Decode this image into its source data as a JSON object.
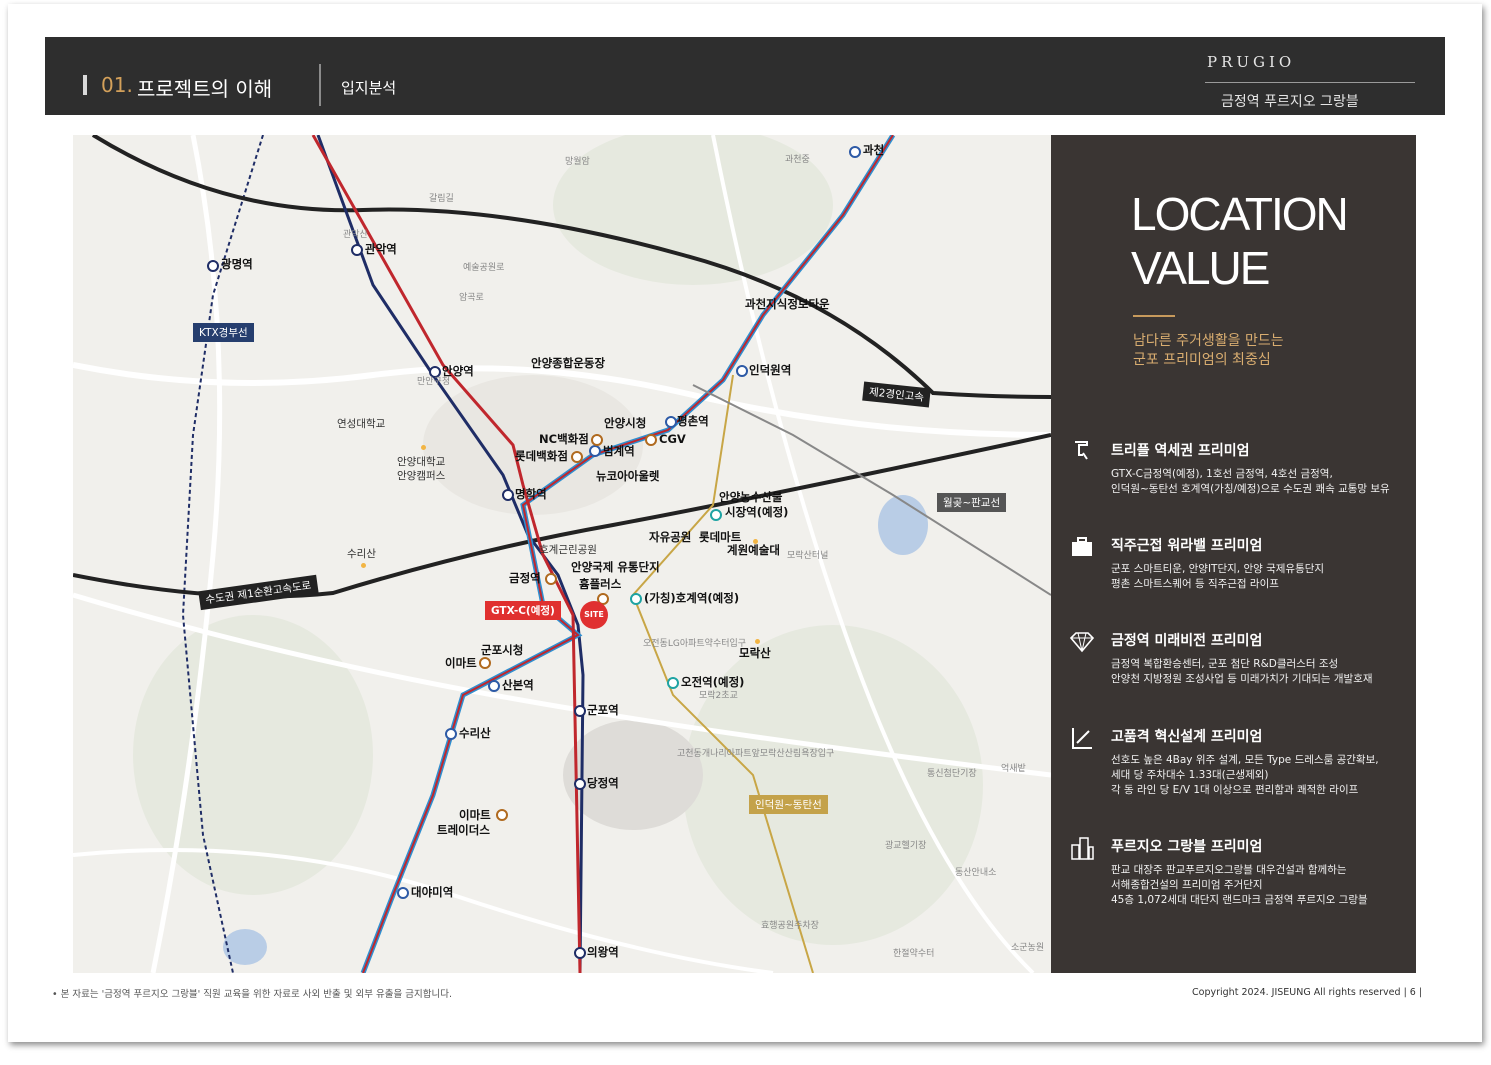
{
  "header": {
    "section_number": "01.",
    "section_title": "프로젝트의 이해",
    "subsection": "입지분석",
    "brand": "PRUGIO",
    "brand_sub": "금정역 푸르지오 그랑블"
  },
  "map": {
    "site_label": "SITE",
    "stations": [
      "과천",
      "관악역",
      "광명역",
      "안양역",
      "과천지식정보타운",
      "인덕원역",
      "안양시청",
      "평촌역",
      "범계역",
      "명학역",
      "금정역",
      "산본역",
      "군포역",
      "수리산",
      "당정역",
      "대야미역",
      "의왕역",
      "시장역(예정)",
      "(가칭)호계역(예정)",
      "오전역(예정)"
    ],
    "places": [
      "NC백화점",
      "CGV",
      "롯데백화점",
      "뉴코아아울렛",
      "안양종합운동장",
      "연성대학교",
      "안양대학교",
      "안양캠퍼스",
      "수리산",
      "호계근린공원",
      "안양국제 유통단지",
      "흄플러스",
      "자유공원",
      "롯데마트",
      "계원예술대",
      "안양농수산물",
      "군포시청",
      "이마트",
      "모락산",
      "이마트",
      "트레이더스"
    ],
    "faint_labels": [
      "망월암",
      "과천중",
      "관악산",
      "갈림길",
      "예술공원로",
      "암곡로",
      "만안구청",
      "모락산터널",
      "오전동LG아파트약수터입구",
      "모락2초교",
      "고천동개나리아파트앞모락산산림욕장입구",
      "통신첨단기장",
      "억새밭",
      "광교헬기장",
      "동산안내소",
      "효행공원주차장",
      "한절약수터",
      "소군농원"
    ],
    "road_tags": {
      "ktx": "KTX경부선",
      "expressway2": "제2경인고속",
      "ring1": "수도권 제1순환고속도로",
      "wolgot": "월곶~판교선",
      "gtxc": "GTX-C(예정)",
      "indeogwon": "인덕원~동탄선"
    }
  },
  "panel": {
    "title_line1": "LOCATION",
    "title_line2": "VALUE",
    "tagline1": "남다른 주거생활을 만드는",
    "tagline2": "군포 프리미엄의 최중심",
    "items": [
      {
        "heading": "트리플 역세권 프리미엄",
        "line1": "GTX-C금정역(예정), 1호선 금정역, 4호선 금정역,",
        "line2": "인덕원~동탄선 호계역(가칭/예정)으로 수도권 쾌속 교통망 보유",
        "line3": ""
      },
      {
        "heading": "직주근접 워라밸 프리미엄",
        "line1": "군포 스마트티운, 안양IT단지, 안양 국제유통단지",
        "line2": "평촌 스마트스퀘어 등 직주근접 라이프",
        "line3": ""
      },
      {
        "heading": "금정역 미래비전 프리미엄",
        "line1": "금정역 복합환승센터, 군포 첨단 R&D클러스터 조성",
        "line2": "안양천 지방정원 조성사업 등 미래가치가 기대되는 개발호재",
        "line3": ""
      },
      {
        "heading": "고품격 혁신설계 프리미엄",
        "line1": "선호도 높은 4Bay 위주 설계, 모든 Type 드레스룸 공간확보,",
        "line2": "세대 당 주차대수 1.33대(근생제외)",
        "line3": "각 동 라인 당 E/V 1대 이상으로 편리함과 쾌적한 라이프"
      },
      {
        "heading": "푸르지오 그랑블 프리미엄",
        "line1": "판교 대장주 판교푸르지오그랑블 대우건설과 함께하는",
        "line2": "서해종합건설의 프리미엄 주거단지",
        "line3": "45층 1,072세대 대단지 랜드마크 금정역 푸르지오 그랑블"
      }
    ]
  },
  "footer": {
    "note": "• 본 자료는 '금정역 푸르지오 그랑블' 직원 교육을 위한 자료로 사외 반출 및 외부 유출을 금지합니다.",
    "copyright": "Copyright 2024. JISEUNG All rights reserved  | 6 |"
  },
  "colors": {
    "header_bg": "#2e2e2e",
    "accent_gold": "#d3a05a",
    "panel_bg": "#3a3533",
    "line_red": "#c0272d",
    "line_blue": "#2f8fd0",
    "line_navy": "#1f2d66",
    "line_gold": "#c8a646"
  }
}
